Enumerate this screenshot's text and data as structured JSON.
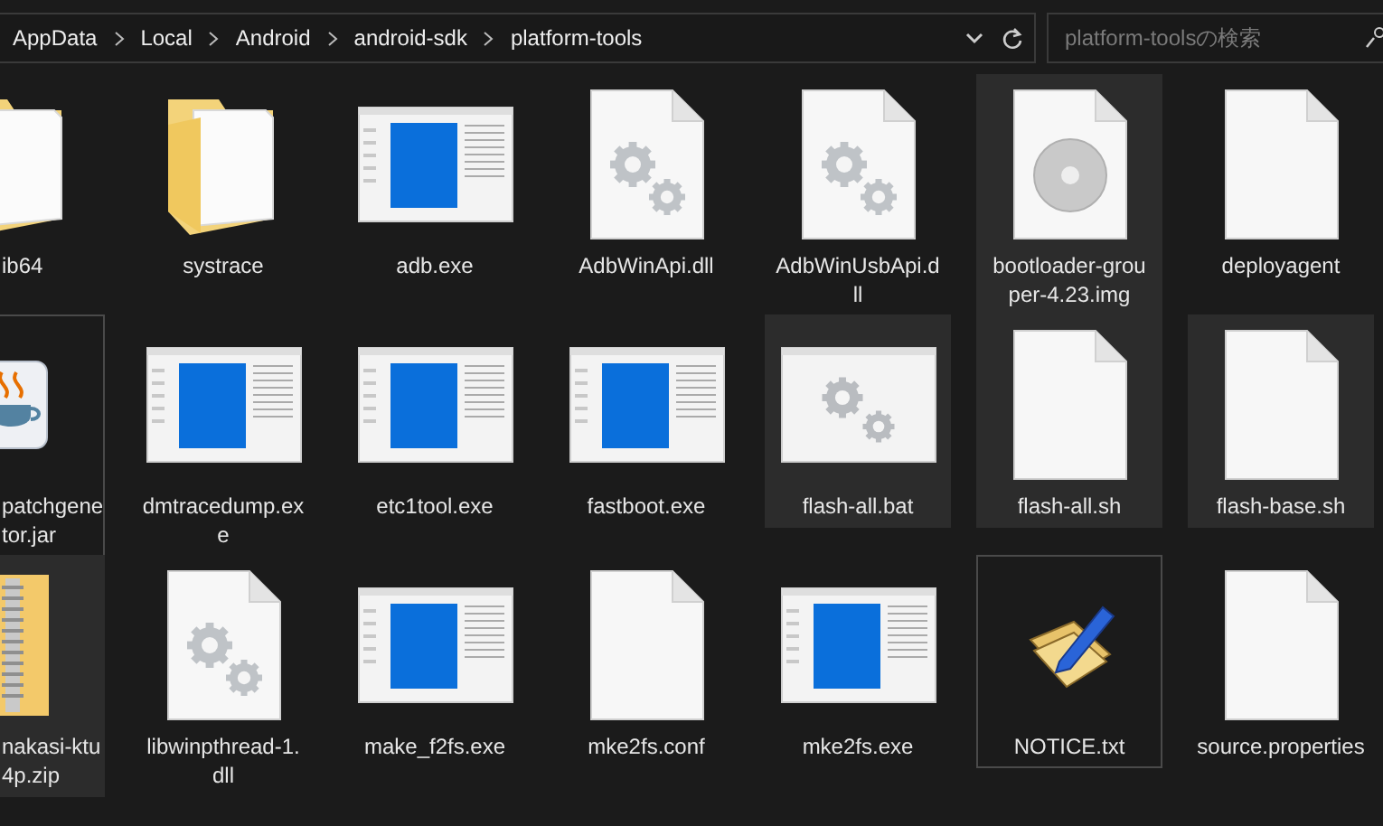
{
  "address_bar": {
    "breadcrumbs": [
      "AppData",
      "Local",
      "Android",
      "android-sdk",
      "platform-tools"
    ]
  },
  "search": {
    "placeholder": "platform-toolsの検索"
  },
  "rows": [
    [
      {
        "kind": "folder",
        "lines": [
          "ib64"
        ],
        "highlighted": false,
        "focused": false
      },
      {
        "kind": "folder",
        "lines": [
          "systrace"
        ],
        "highlighted": false,
        "focused": false
      },
      {
        "kind": "exe",
        "lines": [
          "adb.exe"
        ],
        "highlighted": false,
        "focused": false
      },
      {
        "kind": "dll",
        "lines": [
          "AdbWinApi.dll"
        ],
        "highlighted": false,
        "focused": false
      },
      {
        "kind": "dll",
        "lines": [
          "AdbWinUsbApi.d",
          "ll"
        ],
        "highlighted": false,
        "focused": false
      },
      {
        "kind": "disc",
        "lines": [
          "bootloader-grou",
          "per-4.23.img"
        ],
        "highlighted": true,
        "focused": false
      },
      {
        "kind": "blank",
        "lines": [
          "deployagent"
        ],
        "highlighted": false,
        "focused": false
      }
    ],
    [
      {
        "kind": "java",
        "lines": [
          "patchgene",
          "tor.jar"
        ],
        "highlighted": false,
        "focused": true
      },
      {
        "kind": "exe",
        "lines": [
          "dmtracedump.ex",
          "e"
        ],
        "highlighted": false,
        "focused": false
      },
      {
        "kind": "exe",
        "lines": [
          "etc1tool.exe"
        ],
        "highlighted": false,
        "focused": false
      },
      {
        "kind": "exe",
        "lines": [
          "fastboot.exe"
        ],
        "highlighted": false,
        "focused": false
      },
      {
        "kind": "bat",
        "lines": [
          "flash-all.bat"
        ],
        "highlighted": true,
        "focused": false
      },
      {
        "kind": "blank",
        "lines": [
          "flash-all.sh"
        ],
        "highlighted": true,
        "focused": false
      },
      {
        "kind": "blank",
        "lines": [
          "flash-base.sh"
        ],
        "highlighted": true,
        "focused": false
      }
    ],
    [
      {
        "kind": "zip",
        "lines": [
          "nakasi-ktu",
          "4p.zip"
        ],
        "highlighted": true,
        "focused": false
      },
      {
        "kind": "dll",
        "lines": [
          "libwinpthread-1.",
          "dll"
        ],
        "highlighted": false,
        "focused": false
      },
      {
        "kind": "exe",
        "lines": [
          "make_f2fs.exe"
        ],
        "highlighted": false,
        "focused": false
      },
      {
        "kind": "blank",
        "lines": [
          "mke2fs.conf"
        ],
        "highlighted": false,
        "focused": false
      },
      {
        "kind": "exe",
        "lines": [
          "mke2fs.exe"
        ],
        "highlighted": false,
        "focused": false
      },
      {
        "kind": "notepad",
        "lines": [
          "NOTICE.txt"
        ],
        "highlighted": false,
        "focused": true
      },
      {
        "kind": "blank",
        "lines": [
          "source.properties"
        ],
        "highlighted": false,
        "focused": false
      }
    ]
  ]
}
